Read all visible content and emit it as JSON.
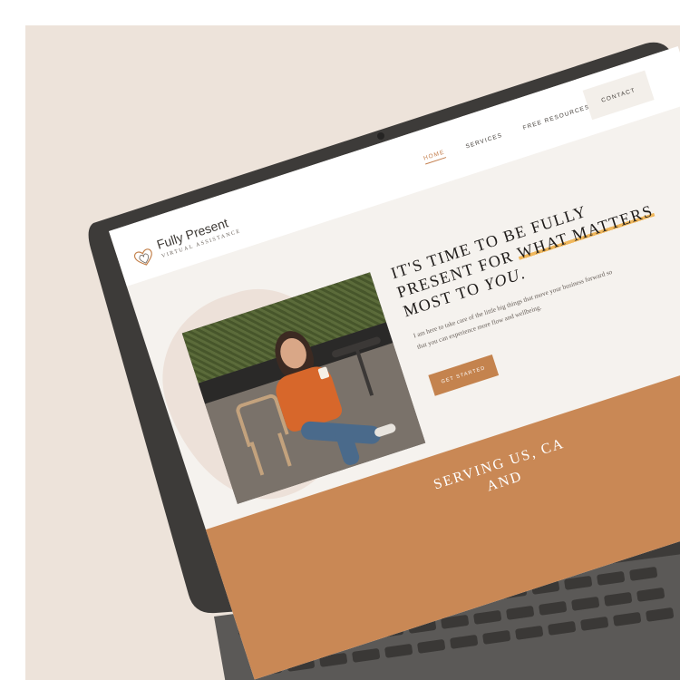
{
  "logo": {
    "title": "Fully Present",
    "subtitle": "VIRTUAL ASSISTANCE"
  },
  "nav": {
    "items": [
      {
        "label": "HOME",
        "active": true
      },
      {
        "label": "SERVICES",
        "active": false
      },
      {
        "label": "FREE RESOURCES",
        "active": false
      }
    ],
    "contact_label": "CONTACT"
  },
  "hero": {
    "line1": "IT'S TIME TO BE FULLY",
    "line2_a": "PRESENT FOR ",
    "line2_b": "WHAT MATTERS",
    "line3_a": "MOST TO ",
    "line3_b": "YOU",
    "line3_c": ".",
    "body": "I am here to take care of the little big things that move your business forward so that you can experience more flow and wellbeing.",
    "cta_label": "GET STARTED"
  },
  "band": {
    "text": "SERVING US, CA AND"
  },
  "colors": {
    "accent": "#c4834e",
    "highlight": "#f0b75b",
    "background": "#ede3da",
    "band": "#c98855"
  }
}
